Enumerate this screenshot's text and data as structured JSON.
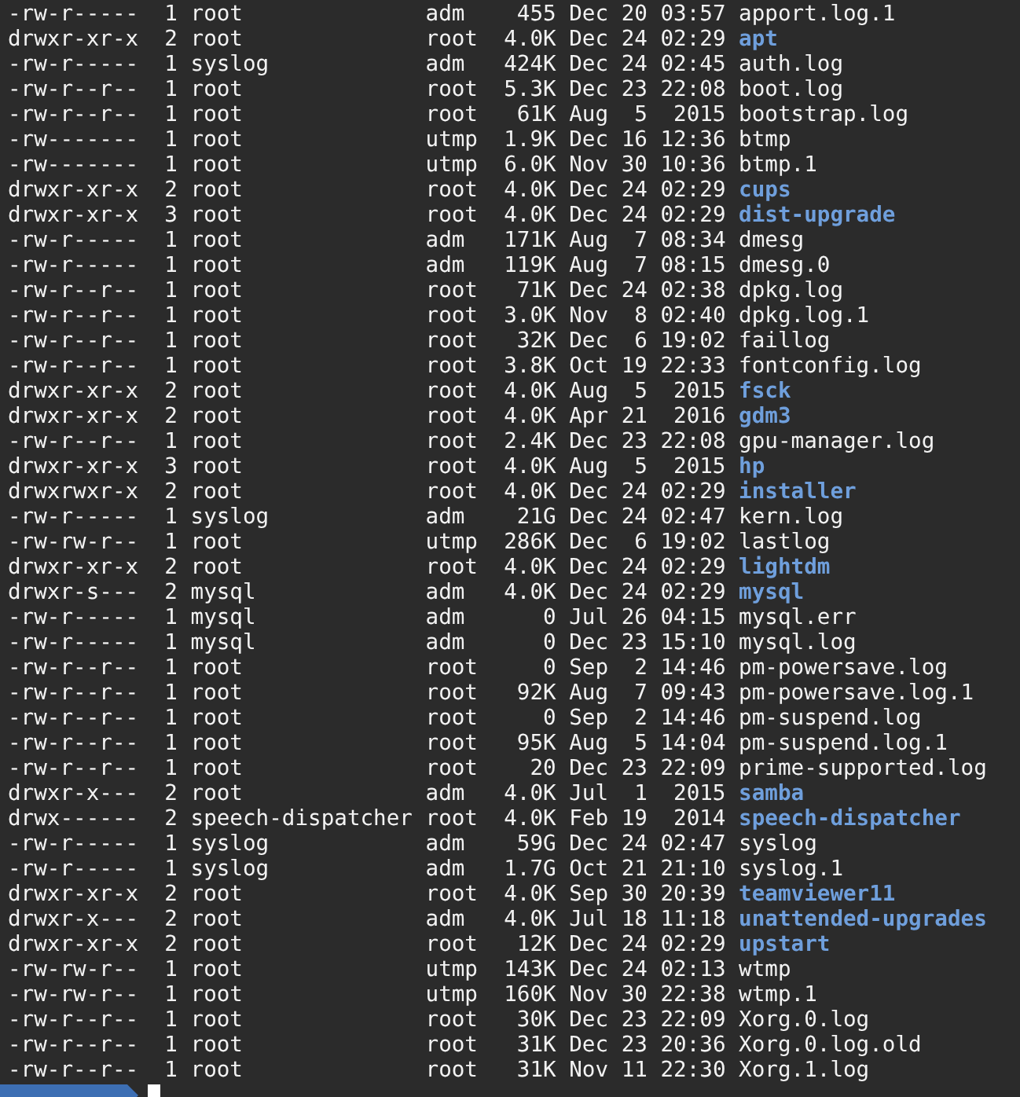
{
  "terminal": {
    "rows": [
      {
        "perms": "-rw-r-----",
        "links": "1",
        "owner": "root",
        "group": "adm",
        "size": "455",
        "month": "Dec",
        "day": "20",
        "time": "03:57",
        "name": "apport.log.1",
        "kind": "file"
      },
      {
        "perms": "drwxr-xr-x",
        "links": "2",
        "owner": "root",
        "group": "root",
        "size": "4.0K",
        "month": "Dec",
        "day": "24",
        "time": "02:29",
        "name": "apt",
        "kind": "dir"
      },
      {
        "perms": "-rw-r-----",
        "links": "1",
        "owner": "syslog",
        "group": "adm",
        "size": "424K",
        "month": "Dec",
        "day": "24",
        "time": "02:45",
        "name": "auth.log",
        "kind": "file"
      },
      {
        "perms": "-rw-r--r--",
        "links": "1",
        "owner": "root",
        "group": "root",
        "size": "5.3K",
        "month": "Dec",
        "day": "23",
        "time": "22:08",
        "name": "boot.log",
        "kind": "file"
      },
      {
        "perms": "-rw-r--r--",
        "links": "1",
        "owner": "root",
        "group": "root",
        "size": "61K",
        "month": "Aug",
        "day": "5",
        "time": "2015",
        "name": "bootstrap.log",
        "kind": "file"
      },
      {
        "perms": "-rw-------",
        "links": "1",
        "owner": "root",
        "group": "utmp",
        "size": "1.9K",
        "month": "Dec",
        "day": "16",
        "time": "12:36",
        "name": "btmp",
        "kind": "file"
      },
      {
        "perms": "-rw-------",
        "links": "1",
        "owner": "root",
        "group": "utmp",
        "size": "6.0K",
        "month": "Nov",
        "day": "30",
        "time": "10:36",
        "name": "btmp.1",
        "kind": "file"
      },
      {
        "perms": "drwxr-xr-x",
        "links": "2",
        "owner": "root",
        "group": "root",
        "size": "4.0K",
        "month": "Dec",
        "day": "24",
        "time": "02:29",
        "name": "cups",
        "kind": "dir"
      },
      {
        "perms": "drwxr-xr-x",
        "links": "3",
        "owner": "root",
        "group": "root",
        "size": "4.0K",
        "month": "Dec",
        "day": "24",
        "time": "02:29",
        "name": "dist-upgrade",
        "kind": "dir"
      },
      {
        "perms": "-rw-r-----",
        "links": "1",
        "owner": "root",
        "group": "adm",
        "size": "171K",
        "month": "Aug",
        "day": "7",
        "time": "08:34",
        "name": "dmesg",
        "kind": "file"
      },
      {
        "perms": "-rw-r-----",
        "links": "1",
        "owner": "root",
        "group": "adm",
        "size": "119K",
        "month": "Aug",
        "day": "7",
        "time": "08:15",
        "name": "dmesg.0",
        "kind": "file"
      },
      {
        "perms": "-rw-r--r--",
        "links": "1",
        "owner": "root",
        "group": "root",
        "size": "71K",
        "month": "Dec",
        "day": "24",
        "time": "02:38",
        "name": "dpkg.log",
        "kind": "file"
      },
      {
        "perms": "-rw-r--r--",
        "links": "1",
        "owner": "root",
        "group": "root",
        "size": "3.0K",
        "month": "Nov",
        "day": "8",
        "time": "02:40",
        "name": "dpkg.log.1",
        "kind": "file"
      },
      {
        "perms": "-rw-r--r--",
        "links": "1",
        "owner": "root",
        "group": "root",
        "size": "32K",
        "month": "Dec",
        "day": "6",
        "time": "19:02",
        "name": "faillog",
        "kind": "file"
      },
      {
        "perms": "-rw-r--r--",
        "links": "1",
        "owner": "root",
        "group": "root",
        "size": "3.8K",
        "month": "Oct",
        "day": "19",
        "time": "22:33",
        "name": "fontconfig.log",
        "kind": "file"
      },
      {
        "perms": "drwxr-xr-x",
        "links": "2",
        "owner": "root",
        "group": "root",
        "size": "4.0K",
        "month": "Aug",
        "day": "5",
        "time": "2015",
        "name": "fsck",
        "kind": "dir"
      },
      {
        "perms": "drwxr-xr-x",
        "links": "2",
        "owner": "root",
        "group": "root",
        "size": "4.0K",
        "month": "Apr",
        "day": "21",
        "time": "2016",
        "name": "gdm3",
        "kind": "dir"
      },
      {
        "perms": "-rw-r--r--",
        "links": "1",
        "owner": "root",
        "group": "root",
        "size": "2.4K",
        "month": "Dec",
        "day": "23",
        "time": "22:08",
        "name": "gpu-manager.log",
        "kind": "file"
      },
      {
        "perms": "drwxr-xr-x",
        "links": "3",
        "owner": "root",
        "group": "root",
        "size": "4.0K",
        "month": "Aug",
        "day": "5",
        "time": "2015",
        "name": "hp",
        "kind": "dir"
      },
      {
        "perms": "drwxrwxr-x",
        "links": "2",
        "owner": "root",
        "group": "root",
        "size": "4.0K",
        "month": "Dec",
        "day": "24",
        "time": "02:29",
        "name": "installer",
        "kind": "dir"
      },
      {
        "perms": "-rw-r-----",
        "links": "1",
        "owner": "syslog",
        "group": "adm",
        "size": "21G",
        "month": "Dec",
        "day": "24",
        "time": "02:47",
        "name": "kern.log",
        "kind": "file"
      },
      {
        "perms": "-rw-rw-r--",
        "links": "1",
        "owner": "root",
        "group": "utmp",
        "size": "286K",
        "month": "Dec",
        "day": "6",
        "time": "19:02",
        "name": "lastlog",
        "kind": "file"
      },
      {
        "perms": "drwxr-xr-x",
        "links": "2",
        "owner": "root",
        "group": "root",
        "size": "4.0K",
        "month": "Dec",
        "day": "24",
        "time": "02:29",
        "name": "lightdm",
        "kind": "dir"
      },
      {
        "perms": "drwxr-s---",
        "links": "2",
        "owner": "mysql",
        "group": "adm",
        "size": "4.0K",
        "month": "Dec",
        "day": "24",
        "time": "02:29",
        "name": "mysql",
        "kind": "dir"
      },
      {
        "perms": "-rw-r-----",
        "links": "1",
        "owner": "mysql",
        "group": "adm",
        "size": "0",
        "month": "Jul",
        "day": "26",
        "time": "04:15",
        "name": "mysql.err",
        "kind": "file"
      },
      {
        "perms": "-rw-r-----",
        "links": "1",
        "owner": "mysql",
        "group": "adm",
        "size": "0",
        "month": "Dec",
        "day": "23",
        "time": "15:10",
        "name": "mysql.log",
        "kind": "file"
      },
      {
        "perms": "-rw-r--r--",
        "links": "1",
        "owner": "root",
        "group": "root",
        "size": "0",
        "month": "Sep",
        "day": "2",
        "time": "14:46",
        "name": "pm-powersave.log",
        "kind": "file"
      },
      {
        "perms": "-rw-r--r--",
        "links": "1",
        "owner": "root",
        "group": "root",
        "size": "92K",
        "month": "Aug",
        "day": "7",
        "time": "09:43",
        "name": "pm-powersave.log.1",
        "kind": "file"
      },
      {
        "perms": "-rw-r--r--",
        "links": "1",
        "owner": "root",
        "group": "root",
        "size": "0",
        "month": "Sep",
        "day": "2",
        "time": "14:46",
        "name": "pm-suspend.log",
        "kind": "file"
      },
      {
        "perms": "-rw-r--r--",
        "links": "1",
        "owner": "root",
        "group": "root",
        "size": "95K",
        "month": "Aug",
        "day": "5",
        "time": "14:04",
        "name": "pm-suspend.log.1",
        "kind": "file"
      },
      {
        "perms": "-rw-r--r--",
        "links": "1",
        "owner": "root",
        "group": "root",
        "size": "20",
        "month": "Dec",
        "day": "23",
        "time": "22:09",
        "name": "prime-supported.log",
        "kind": "file"
      },
      {
        "perms": "drwxr-x---",
        "links": "2",
        "owner": "root",
        "group": "adm",
        "size": "4.0K",
        "month": "Jul",
        "day": "1",
        "time": "2015",
        "name": "samba",
        "kind": "dir"
      },
      {
        "perms": "drwx------",
        "links": "2",
        "owner": "speech-dispatcher",
        "group": "root",
        "size": "4.0K",
        "month": "Feb",
        "day": "19",
        "time": "2014",
        "name": "speech-dispatcher",
        "kind": "dir"
      },
      {
        "perms": "-rw-r-----",
        "links": "1",
        "owner": "syslog",
        "group": "adm",
        "size": "59G",
        "month": "Dec",
        "day": "24",
        "time": "02:47",
        "name": "syslog",
        "kind": "file"
      },
      {
        "perms": "-rw-r-----",
        "links": "1",
        "owner": "syslog",
        "group": "adm",
        "size": "1.7G",
        "month": "Oct",
        "day": "21",
        "time": "21:10",
        "name": "syslog.1",
        "kind": "file"
      },
      {
        "perms": "drwxr-xr-x",
        "links": "2",
        "owner": "root",
        "group": "root",
        "size": "4.0K",
        "month": "Sep",
        "day": "30",
        "time": "20:39",
        "name": "teamviewer11",
        "kind": "dir"
      },
      {
        "perms": "drwxr-x---",
        "links": "2",
        "owner": "root",
        "group": "adm",
        "size": "4.0K",
        "month": "Jul",
        "day": "18",
        "time": "11:18",
        "name": "unattended-upgrades",
        "kind": "dir"
      },
      {
        "perms": "drwxr-xr-x",
        "links": "2",
        "owner": "root",
        "group": "root",
        "size": "12K",
        "month": "Dec",
        "day": "24",
        "time": "02:29",
        "name": "upstart",
        "kind": "dir"
      },
      {
        "perms": "-rw-rw-r--",
        "links": "1",
        "owner": "root",
        "group": "utmp",
        "size": "143K",
        "month": "Dec",
        "day": "24",
        "time": "02:13",
        "name": "wtmp",
        "kind": "file"
      },
      {
        "perms": "-rw-rw-r--",
        "links": "1",
        "owner": "root",
        "group": "utmp",
        "size": "160K",
        "month": "Nov",
        "day": "30",
        "time": "22:38",
        "name": "wtmp.1",
        "kind": "file"
      },
      {
        "perms": "-rw-r--r--",
        "links": "1",
        "owner": "root",
        "group": "root",
        "size": "30K",
        "month": "Dec",
        "day": "23",
        "time": "22:09",
        "name": "Xorg.0.log",
        "kind": "file"
      },
      {
        "perms": "-rw-r--r--",
        "links": "1",
        "owner": "root",
        "group": "root",
        "size": "31K",
        "month": "Dec",
        "day": "23",
        "time": "20:36",
        "name": "Xorg.0.log.old",
        "kind": "file"
      },
      {
        "perms": "-rw-r--r--",
        "links": "1",
        "owner": "root",
        "group": "root",
        "size": "31K",
        "month": "Nov",
        "day": "11",
        "time": "22:30",
        "name": "Xorg.1.log",
        "kind": "file"
      }
    ]
  }
}
